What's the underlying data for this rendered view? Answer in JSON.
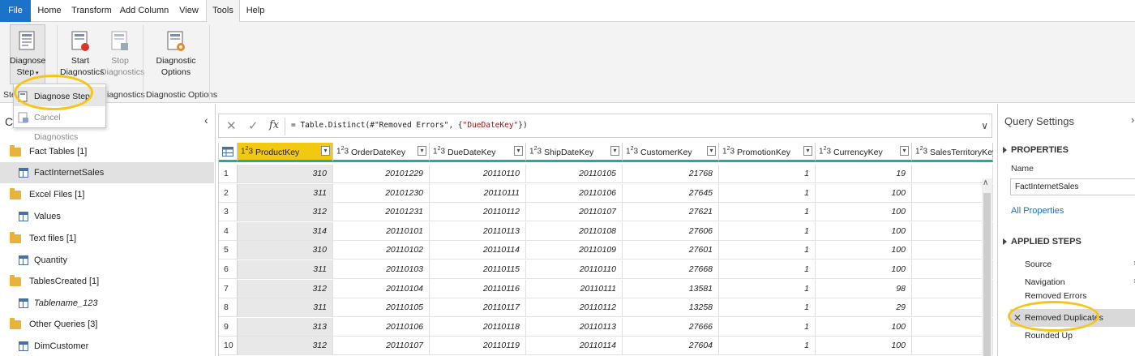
{
  "tabs": [
    "File",
    "Home",
    "Transform",
    "Add Column",
    "View",
    "Tools",
    "Help"
  ],
  "ribbon": {
    "diagnose_step": {
      "line1": "Diagnose",
      "line2": "Step"
    },
    "start_diag": {
      "line1": "Start",
      "line2": "Diagnostics"
    },
    "stop_diag": {
      "line1": "Stop",
      "line2": "Diagnostics"
    },
    "diag_options": {
      "line1": "Diagnostic",
      "line2": "Options"
    },
    "group_step": "Ste",
    "group_diagnostics": "iagnostics",
    "group_options": "Diagnostic Options"
  },
  "dropdown": {
    "diagnose_step": "Diagnose Step",
    "cancel": "Cancel Diagnostics"
  },
  "queries_pane": {
    "title": "C",
    "items": [
      {
        "type": "folder",
        "label": "Fact Tables [1]"
      },
      {
        "type": "table",
        "label": "FactInternetSales",
        "selected": true
      },
      {
        "type": "folder",
        "label": "Excel Files [1]"
      },
      {
        "type": "table",
        "label": "Values"
      },
      {
        "type": "folder",
        "label": "Text files [1]"
      },
      {
        "type": "table",
        "label": "Quantity"
      },
      {
        "type": "folder",
        "label": "TablesCreated [1]"
      },
      {
        "type": "table",
        "label": "Tablename_123",
        "italic": true
      },
      {
        "type": "folder",
        "label": "Other Queries [3]"
      },
      {
        "type": "table",
        "label": "DimCustomer"
      }
    ]
  },
  "formula": {
    "prefix": "= Table.Distinct(#\"Removed Errors\", {",
    "string": "\"DueDateKey\"",
    "suffix": "})"
  },
  "grid": {
    "type_label": "1",
    "type_sup": "2",
    "type_sub": "3",
    "columns": [
      "ProductKey",
      "OrderDateKey",
      "DueDateKey",
      "ShipDateKey",
      "CustomerKey",
      "PromotionKey",
      "CurrencyKey",
      "SalesTerritoryKey"
    ],
    "rows": [
      [
        "1",
        "310",
        "20101229",
        "20110110",
        "20110105",
        "21768",
        "1",
        "19"
      ],
      [
        "2",
        "311",
        "20101230",
        "20110111",
        "20110106",
        "27645",
        "1",
        "100"
      ],
      [
        "3",
        "312",
        "20101231",
        "20110112",
        "20110107",
        "27621",
        "1",
        "100"
      ],
      [
        "4",
        "314",
        "20110101",
        "20110113",
        "20110108",
        "27606",
        "1",
        "100"
      ],
      [
        "5",
        "310",
        "20110102",
        "20110114",
        "20110109",
        "27601",
        "1",
        "100"
      ],
      [
        "6",
        "311",
        "20110103",
        "20110115",
        "20110110",
        "27668",
        "1",
        "100"
      ],
      [
        "7",
        "312",
        "20110104",
        "20110116",
        "20110111",
        "13581",
        "1",
        "98"
      ],
      [
        "8",
        "311",
        "20110105",
        "20110117",
        "20110112",
        "13258",
        "1",
        "29"
      ],
      [
        "9",
        "313",
        "20110106",
        "20110118",
        "20110113",
        "27666",
        "1",
        "100"
      ],
      [
        "10",
        "312",
        "20110107",
        "20110119",
        "20110114",
        "27604",
        "1",
        "100"
      ]
    ]
  },
  "query_settings": {
    "title": "Query Settings",
    "properties": "PROPERTIES",
    "name_label": "Name",
    "name_value": "FactInternetSales",
    "all_properties": "All Properties",
    "applied_steps": "APPLIED STEPS",
    "steps": [
      "Source",
      "Navigation",
      "Removed Errors",
      "Removed Duplicates",
      "Rounded Up"
    ]
  },
  "colors": {
    "accent": "#1a73c8",
    "selected_header": "#f2c811",
    "header_border": "#1fae9a",
    "callout": "#f5c518"
  }
}
